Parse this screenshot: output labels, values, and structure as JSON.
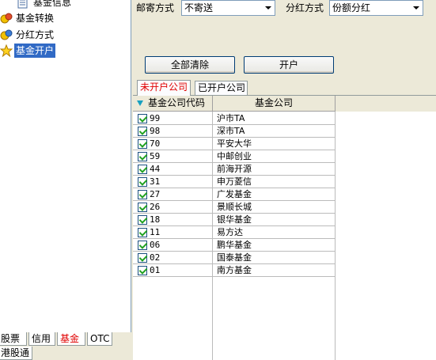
{
  "sidebar": {
    "tree": [
      {
        "label": "基金信息",
        "icon": "document-icon",
        "selected": false
      },
      {
        "label": "基金转换",
        "icon": "fund-icon",
        "selected": false
      },
      {
        "label": "分红方式",
        "icon": "fund-icon",
        "selected": false
      },
      {
        "label": "基金开户",
        "icon": "star-icon",
        "selected": true
      }
    ],
    "tabs": [
      "股票",
      "信用",
      "基金",
      "OTC",
      "港股通"
    ],
    "active_tab": "基金"
  },
  "form": {
    "mail_label": "邮寄方式",
    "mail_value": "不寄送",
    "dividend_label": "分红方式",
    "dividend_value": "份额分红"
  },
  "buttons": {
    "clear_all": "全部清除",
    "open_account": "开户"
  },
  "tabs": {
    "unopened": "未开户公司",
    "opened": "已开户公司",
    "active": "未开户公司"
  },
  "grid": {
    "columns": [
      "基金公司代码",
      "基金公司"
    ],
    "rows": [
      {
        "code": "99",
        "name": "沪市TA",
        "checked": true
      },
      {
        "code": "98",
        "name": "深市TA",
        "checked": true
      },
      {
        "code": "70",
        "name": "平安大华",
        "checked": true
      },
      {
        "code": "59",
        "name": "中邮创业",
        "checked": true
      },
      {
        "code": "44",
        "name": "前海开源",
        "checked": true
      },
      {
        "code": "31",
        "name": "申万菱信",
        "checked": true
      },
      {
        "code": "27",
        "name": "广发基金",
        "checked": true
      },
      {
        "code": "26",
        "name": "景顺长城",
        "checked": true
      },
      {
        "code": "18",
        "name": "银华基金",
        "checked": true
      },
      {
        "code": "11",
        "name": "易方达",
        "checked": true
      },
      {
        "code": "06",
        "name": "鹏华基金",
        "checked": true
      },
      {
        "code": "02",
        "name": "国泰基金",
        "checked": true
      },
      {
        "code": "01",
        "name": "南方基金",
        "checked": true
      }
    ]
  },
  "colors": {
    "selection": "#316ac5",
    "active_tab_text": "#e00000",
    "checkmark": "#21a121"
  }
}
